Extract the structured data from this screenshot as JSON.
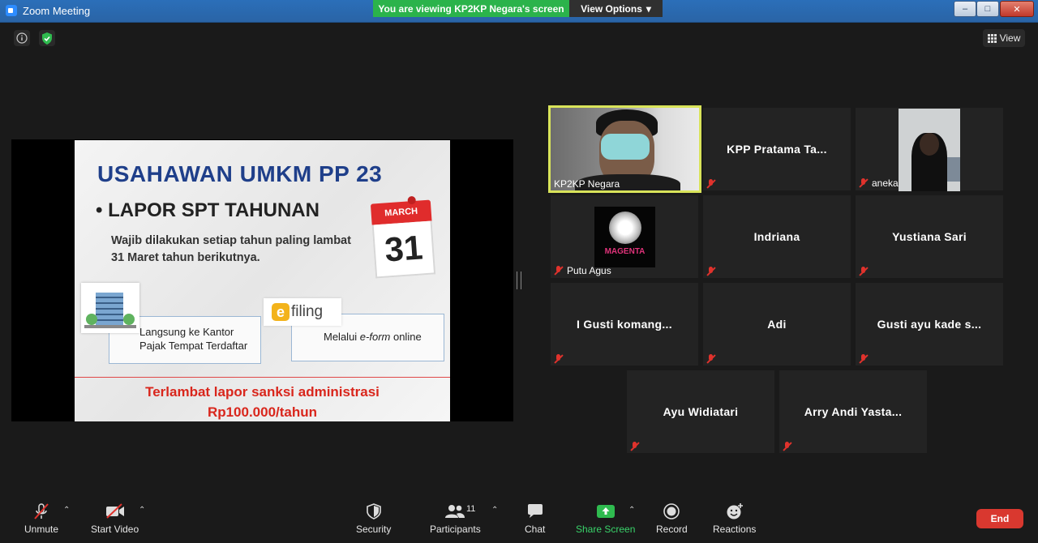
{
  "window": {
    "title": "Zoom Meeting"
  },
  "banner": {
    "viewing": "You are viewing KP2KP Negara's screen",
    "view_options": "View Options"
  },
  "top_right": {
    "view_label": "View"
  },
  "slide": {
    "title": "USAHAWAN UMKM PP 23",
    "bullet": "• LAPOR SPT TAHUNAN",
    "desc": "Wajib dilakukan setiap tahun paling lambat 31 Maret tahun berikutnya.",
    "calendar_month": "MARCH",
    "calendar_day": "31",
    "option1": "Langsung ke Kantor Pajak Tempat Terdaftar",
    "efiling_e": "e",
    "efiling_text": "filing",
    "option2_pre": "Melalui ",
    "option2_em": "e-form",
    "option2_post": " online",
    "warn1": "Terlambat lapor sanksi administrasi",
    "warn2": "Rp100.000/tahun"
  },
  "participants": [
    {
      "name": "KP2KP Negara",
      "muted": false
    },
    {
      "name": "KPP Pratama Ta..."
    },
    {
      "name": "aneka"
    },
    {
      "name": "Putu Agus"
    },
    {
      "name": "Indriana"
    },
    {
      "name": "Yustiana Sari"
    },
    {
      "name": "I Gusti komang..."
    },
    {
      "name": "Adi"
    },
    {
      "name": "Gusti ayu kade s..."
    },
    {
      "name": "Ayu Widiatari"
    },
    {
      "name": "Arry Andi Yasta..."
    }
  ],
  "putu_brand": "MAGENTA",
  "toolbar": {
    "unmute": "Unmute",
    "start_video": "Start Video",
    "security": "Security",
    "participants": "Participants",
    "participants_count": "11",
    "chat": "Chat",
    "share_screen": "Share Screen",
    "record": "Record",
    "reactions": "Reactions",
    "end": "End"
  },
  "colors": {
    "active_speaker": "#d9e45a",
    "share_green": "#2bb34b",
    "end_red": "#d9382f",
    "muted_red": "#e0322c"
  }
}
